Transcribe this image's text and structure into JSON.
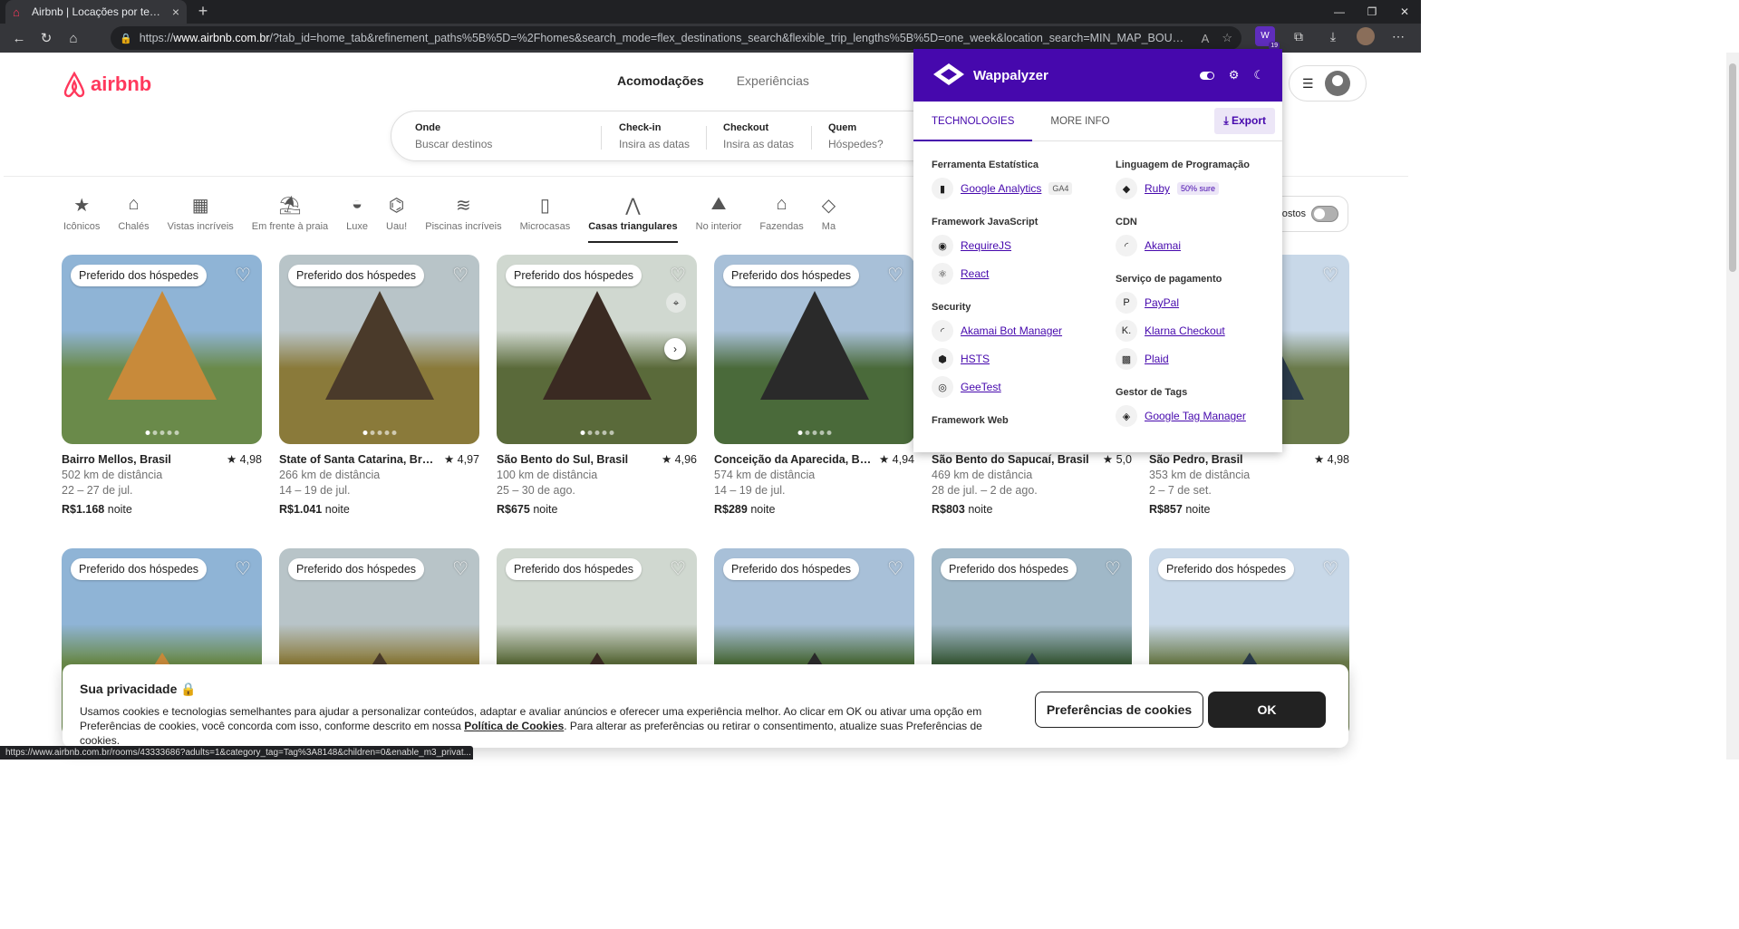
{
  "browser": {
    "tab_title": "Airbnb | Locações por temporada, cabanas, casas de praia",
    "url_prefix": "https://",
    "url_host": "www.airbnb.com.br",
    "url_rest": "/?tab_id=home_tab&refinement_paths%5B%5D=%2Fhomes&search_mode=flex_destinations_search&flexible_trip_lengths%5B%5D=one_week&location_search=MIN_MAP_BOUNDS&monthly_start_d...",
    "ext_badge": "19",
    "status_url": "https://www.airbnb.com.br/rooms/43333686?adults=1&category_tag=Tag%3A8148&children=0&enable_m3_privat..."
  },
  "header": {
    "logo_text": "airbnb",
    "nav": [
      "Acomodações",
      "Experiências"
    ]
  },
  "search": {
    "fields": [
      {
        "label": "Onde",
        "value": "Buscar destinos"
      },
      {
        "label": "Check-in",
        "value": "Insira as datas"
      },
      {
        "label": "Checkout",
        "value": "Insira as datas"
      },
      {
        "label": "Quem",
        "value": "Hóspedes?"
      }
    ]
  },
  "categories": [
    {
      "label": "Icônicos",
      "icon": "★"
    },
    {
      "label": "Chalés",
      "icon": "⌂"
    },
    {
      "label": "Vistas incríveis",
      "icon": "▦"
    },
    {
      "label": "Em frente à praia",
      "icon": "⛱"
    },
    {
      "label": "Luxe",
      "icon": "◒"
    },
    {
      "label": "Uau!",
      "icon": "⌬"
    },
    {
      "label": "Piscinas incríveis",
      "icon": "≋"
    },
    {
      "label": "Microcasas",
      "icon": "▯"
    },
    {
      "label": "Casas triangulares",
      "icon": "⋀"
    },
    {
      "label": "No interior",
      "icon": "⛰"
    },
    {
      "label": "Fazendas",
      "icon": "⌂"
    },
    {
      "label": "Ma",
      "icon": "◇"
    }
  ],
  "filters": {
    "label": "ostos"
  },
  "listings": [
    {
      "badge": "Preferido dos hóspedes",
      "loc": "Bairro Mellos, Brasil",
      "rating": "4,98",
      "dist": "502 km de distância",
      "dates": "22 – 27 de jul.",
      "price": "R$1.168",
      "unit": "noite"
    },
    {
      "badge": "Preferido dos hóspedes",
      "loc": "State of Santa Catarina, Brasil",
      "rating": "4,97",
      "dist": "266 km de distância",
      "dates": "14 – 19 de jul.",
      "price": "R$1.041",
      "unit": "noite"
    },
    {
      "badge": "Preferido dos hóspedes",
      "loc": "São Bento do Sul, Brasil",
      "rating": "4,96",
      "dist": "100 km de distância",
      "dates": "25 – 30 de ago.",
      "price": "R$675",
      "unit": "noite"
    },
    {
      "badge": "Preferido dos hóspedes",
      "loc": "Conceição da Aparecida, Bra...",
      "rating": "4,94",
      "dist": "574 km de distância",
      "dates": "14 – 19 de jul.",
      "price": "R$289",
      "unit": "noite"
    },
    {
      "badge": "",
      "loc": "São Bento do Sapucaí, Brasil",
      "rating": "5,0",
      "dist": "469 km de distância",
      "dates": "28 de jul. – 2 de ago.",
      "price": "R$803",
      "unit": "noite"
    },
    {
      "badge": "",
      "loc": "São Pedro, Brasil",
      "rating": "4,98",
      "dist": "353 km de distância",
      "dates": "2 – 7 de set.",
      "price": "R$857",
      "unit": "noite"
    },
    {
      "badge": "Preferido dos hóspedes"
    },
    {
      "badge": "Preferido dos hóspedes"
    },
    {
      "badge": "Preferido dos hóspedes"
    },
    {
      "badge": "Preferido dos hóspedes"
    },
    {
      "badge": "Preferido dos hóspedes"
    },
    {
      "badge": "Preferido dos hóspedes"
    }
  ],
  "wappalyzer": {
    "title": "Wappalyzer",
    "tabs": [
      "TECHNOLOGIES",
      "MORE INFO"
    ],
    "export": "Export",
    "left": [
      {
        "cat": "Ferramenta Estatística",
        "techs": [
          {
            "name": "Google Analytics",
            "tag": "GA4",
            "icon": "▮"
          }
        ]
      },
      {
        "cat": "Framework JavaScript",
        "techs": [
          {
            "name": "RequireJS",
            "tag": "",
            "icon": "◉"
          },
          {
            "name": "React",
            "tag": "",
            "icon": "⚛"
          }
        ]
      },
      {
        "cat": "Security",
        "techs": [
          {
            "name": "Akamai Bot Manager",
            "tag": "",
            "icon": "◜"
          },
          {
            "name": "HSTS",
            "tag": "",
            "icon": "⬢"
          },
          {
            "name": "GeeTest",
            "tag": "",
            "icon": "◎"
          }
        ]
      },
      {
        "cat": "Framework Web",
        "techs": []
      }
    ],
    "right": [
      {
        "cat": "Linguagem de Programação",
        "techs": [
          {
            "name": "Ruby",
            "tag": "50% sure",
            "icon": "◆"
          }
        ]
      },
      {
        "cat": "CDN",
        "techs": [
          {
            "name": "Akamai",
            "tag": "",
            "icon": "◜"
          }
        ]
      },
      {
        "cat": "Serviço de pagamento",
        "techs": [
          {
            "name": "PayPal",
            "tag": "",
            "icon": "P"
          },
          {
            "name": "Klarna Checkout",
            "tag": "",
            "icon": "K."
          },
          {
            "name": "Plaid",
            "tag": "",
            "icon": "▩"
          }
        ]
      },
      {
        "cat": "Gestor de Tags",
        "techs": [
          {
            "name": "Google Tag Manager",
            "tag": "",
            "icon": "◈"
          }
        ]
      }
    ]
  },
  "cookie": {
    "title": "Sua privacidade",
    "text1": "Usamos cookies e tecnologias semelhantes para ajudar a personalizar conteúdos, adaptar e avaliar anúncios e oferecer uma experiência melhor. Ao clicar em OK ou ativar uma opção em Preferências de cookies, você concorda com isso, conforme descrito em nossa ",
    "link": "Política de Cookies",
    "text2": ". Para alterar as preferências ou retirar o consentimento, atualize suas Preferências de cookies.",
    "pref_btn": "Preferências de cookies",
    "ok_btn": "OK"
  },
  "colors": {
    "brand": "#ff385c",
    "wappalyzer": "#4608ad"
  }
}
